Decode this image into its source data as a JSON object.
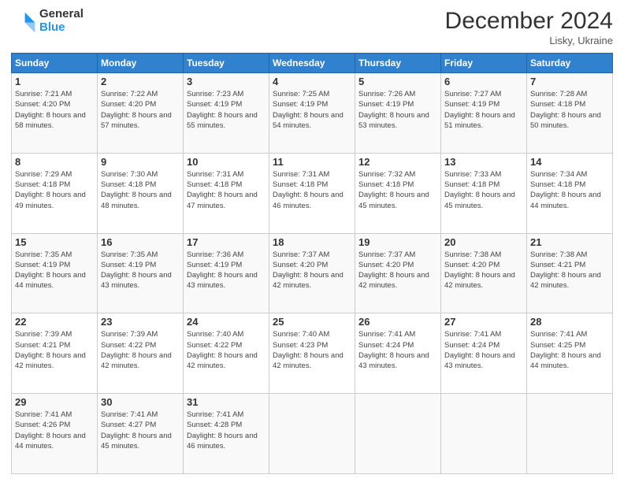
{
  "logo": {
    "general": "General",
    "blue": "Blue"
  },
  "header": {
    "month": "December 2024",
    "location": "Lisky, Ukraine"
  },
  "weekdays": [
    "Sunday",
    "Monday",
    "Tuesday",
    "Wednesday",
    "Thursday",
    "Friday",
    "Saturday"
  ],
  "weeks": [
    [
      {
        "day": "1",
        "sunrise": "7:21 AM",
        "sunset": "4:20 PM",
        "daylight": "8 hours and 58 minutes."
      },
      {
        "day": "2",
        "sunrise": "7:22 AM",
        "sunset": "4:20 PM",
        "daylight": "8 hours and 57 minutes."
      },
      {
        "day": "3",
        "sunrise": "7:23 AM",
        "sunset": "4:19 PM",
        "daylight": "8 hours and 55 minutes."
      },
      {
        "day": "4",
        "sunrise": "7:25 AM",
        "sunset": "4:19 PM",
        "daylight": "8 hours and 54 minutes."
      },
      {
        "day": "5",
        "sunrise": "7:26 AM",
        "sunset": "4:19 PM",
        "daylight": "8 hours and 53 minutes."
      },
      {
        "day": "6",
        "sunrise": "7:27 AM",
        "sunset": "4:19 PM",
        "daylight": "8 hours and 51 minutes."
      },
      {
        "day": "7",
        "sunrise": "7:28 AM",
        "sunset": "4:18 PM",
        "daylight": "8 hours and 50 minutes."
      }
    ],
    [
      {
        "day": "8",
        "sunrise": "7:29 AM",
        "sunset": "4:18 PM",
        "daylight": "8 hours and 49 minutes."
      },
      {
        "day": "9",
        "sunrise": "7:30 AM",
        "sunset": "4:18 PM",
        "daylight": "8 hours and 48 minutes."
      },
      {
        "day": "10",
        "sunrise": "7:31 AM",
        "sunset": "4:18 PM",
        "daylight": "8 hours and 47 minutes."
      },
      {
        "day": "11",
        "sunrise": "7:31 AM",
        "sunset": "4:18 PM",
        "daylight": "8 hours and 46 minutes."
      },
      {
        "day": "12",
        "sunrise": "7:32 AM",
        "sunset": "4:18 PM",
        "daylight": "8 hours and 45 minutes."
      },
      {
        "day": "13",
        "sunrise": "7:33 AM",
        "sunset": "4:18 PM",
        "daylight": "8 hours and 45 minutes."
      },
      {
        "day": "14",
        "sunrise": "7:34 AM",
        "sunset": "4:18 PM",
        "daylight": "8 hours and 44 minutes."
      }
    ],
    [
      {
        "day": "15",
        "sunrise": "7:35 AM",
        "sunset": "4:19 PM",
        "daylight": "8 hours and 44 minutes."
      },
      {
        "day": "16",
        "sunrise": "7:35 AM",
        "sunset": "4:19 PM",
        "daylight": "8 hours and 43 minutes."
      },
      {
        "day": "17",
        "sunrise": "7:36 AM",
        "sunset": "4:19 PM",
        "daylight": "8 hours and 43 minutes."
      },
      {
        "day": "18",
        "sunrise": "7:37 AM",
        "sunset": "4:20 PM",
        "daylight": "8 hours and 42 minutes."
      },
      {
        "day": "19",
        "sunrise": "7:37 AM",
        "sunset": "4:20 PM",
        "daylight": "8 hours and 42 minutes."
      },
      {
        "day": "20",
        "sunrise": "7:38 AM",
        "sunset": "4:20 PM",
        "daylight": "8 hours and 42 minutes."
      },
      {
        "day": "21",
        "sunrise": "7:38 AM",
        "sunset": "4:21 PM",
        "daylight": "8 hours and 42 minutes."
      }
    ],
    [
      {
        "day": "22",
        "sunrise": "7:39 AM",
        "sunset": "4:21 PM",
        "daylight": "8 hours and 42 minutes."
      },
      {
        "day": "23",
        "sunrise": "7:39 AM",
        "sunset": "4:22 PM",
        "daylight": "8 hours and 42 minutes."
      },
      {
        "day": "24",
        "sunrise": "7:40 AM",
        "sunset": "4:22 PM",
        "daylight": "8 hours and 42 minutes."
      },
      {
        "day": "25",
        "sunrise": "7:40 AM",
        "sunset": "4:23 PM",
        "daylight": "8 hours and 42 minutes."
      },
      {
        "day": "26",
        "sunrise": "7:41 AM",
        "sunset": "4:24 PM",
        "daylight": "8 hours and 43 minutes."
      },
      {
        "day": "27",
        "sunrise": "7:41 AM",
        "sunset": "4:24 PM",
        "daylight": "8 hours and 43 minutes."
      },
      {
        "day": "28",
        "sunrise": "7:41 AM",
        "sunset": "4:25 PM",
        "daylight": "8 hours and 44 minutes."
      }
    ],
    [
      {
        "day": "29",
        "sunrise": "7:41 AM",
        "sunset": "4:26 PM",
        "daylight": "8 hours and 44 minutes."
      },
      {
        "day": "30",
        "sunrise": "7:41 AM",
        "sunset": "4:27 PM",
        "daylight": "8 hours and 45 minutes."
      },
      {
        "day": "31",
        "sunrise": "7:41 AM",
        "sunset": "4:28 PM",
        "daylight": "8 hours and 46 minutes."
      },
      null,
      null,
      null,
      null
    ]
  ]
}
